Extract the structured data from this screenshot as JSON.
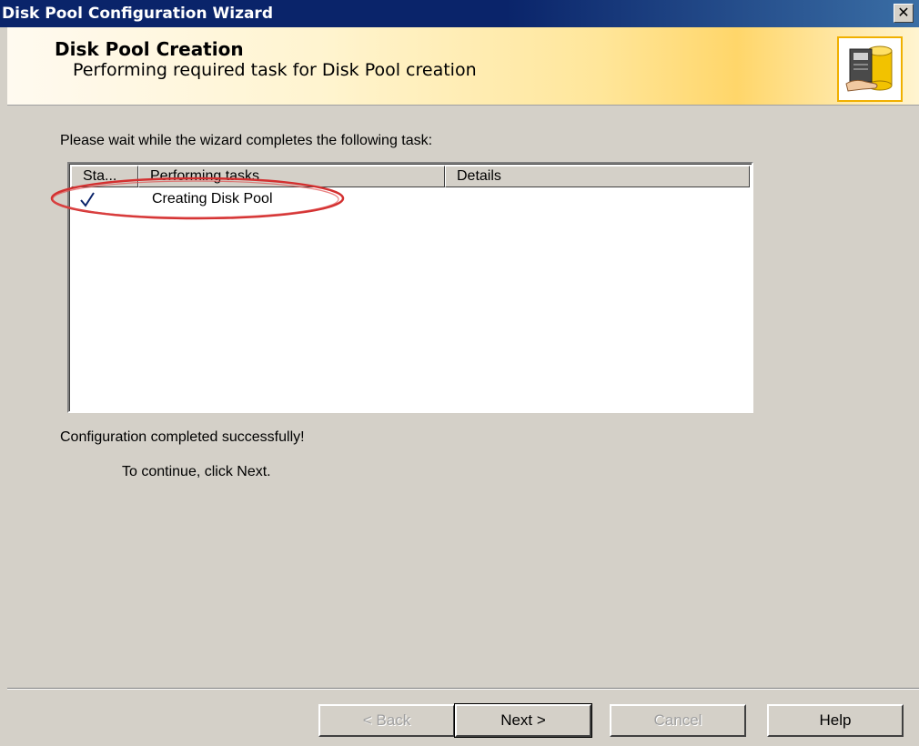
{
  "window": {
    "title": "Disk Pool Configuration Wizard",
    "close_label": "✕"
  },
  "header": {
    "title": "Disk Pool Creation",
    "subtitle": "Performing required task for Disk Pool creation",
    "icon": "disk-pool-server-icon"
  },
  "main": {
    "instruction": "Please wait while the wizard completes the following task:",
    "task_list": {
      "columns": [
        "Sta...",
        "Performing tasks",
        "Details"
      ],
      "rows": [
        {
          "status_icon": "checkmark-icon",
          "task": "Creating Disk Pool",
          "details": ""
        }
      ]
    },
    "status_message": "Configuration completed successfully!",
    "continue_message": "To continue, click Next."
  },
  "footer": {
    "back_label": "< Back",
    "next_label": "Next >",
    "cancel_label": "Cancel",
    "help_label": "Help"
  },
  "colors": {
    "title_bar": "#0a246a",
    "dialog_background": "#d4d0c8",
    "header_gradient_accent": "#ffd66a",
    "checkmark": "#0a246a",
    "annotation": "#d33030"
  }
}
